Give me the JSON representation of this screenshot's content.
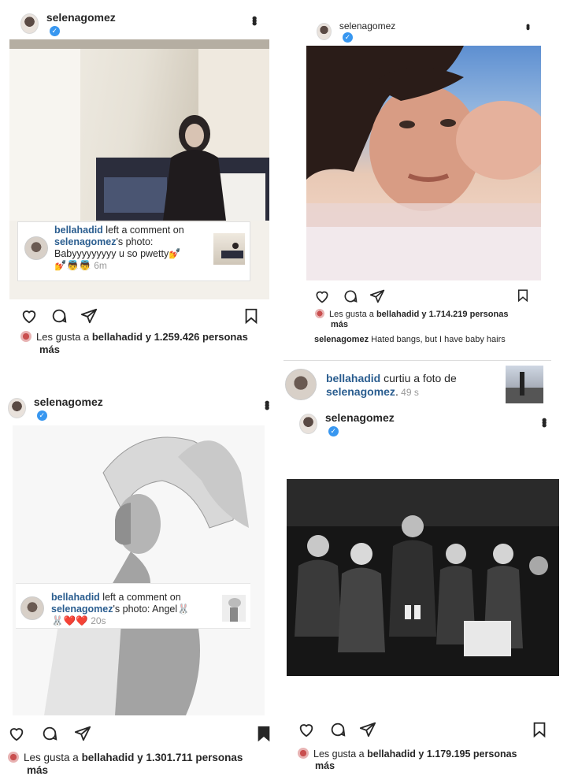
{
  "posts": [
    {
      "username": "selenagomez",
      "likes_prefix": "Les gusta a ",
      "likes_user": "bellahadid",
      "likes_suffix": " y 1.259.426 personas",
      "likes_more": "más",
      "overlay": {
        "user": "bellahadid",
        "line1_rest": " left a comment on",
        "target": "selenagomez",
        "line2_rest": "'s photo:",
        "comment": "Babyyyyyyyyy u so pwetty💅",
        "emojis": "💅👼👼",
        "time": "6m"
      }
    },
    {
      "username": "selenagomez",
      "likes_prefix": "Les gusta a ",
      "likes_user": "bellahadid",
      "likes_suffix": " y 1.714.219 personas",
      "likes_more": "más",
      "caption_user": "selenagomez",
      "caption_text": " Hated bangs, but I have baby hairs"
    },
    {
      "username": "selenagomez",
      "likes_prefix": "Les gusta a ",
      "likes_user": "bellahadid",
      "likes_suffix": " y 1.301.711 personas",
      "likes_more": "más",
      "overlay": {
        "user": "bellahadid",
        "line1_rest": " left a comment on",
        "target": "selenagomez",
        "line2_rest": "'s photo: Angel🐰",
        "emojis": "🐰❤️❤️",
        "time": "20s"
      }
    },
    {
      "username": "selenagomez",
      "likes_prefix": "Les gusta a ",
      "likes_user": "bellahadid",
      "likes_suffix": " y 1.179.195 personas",
      "likes_more": "más",
      "notification": {
        "user": "bellahadid",
        "action": " curtiu a foto de",
        "target": "selenagomez",
        "time": " 49 s"
      }
    }
  ],
  "icons": {
    "verified": "✓",
    "more": "•••"
  }
}
